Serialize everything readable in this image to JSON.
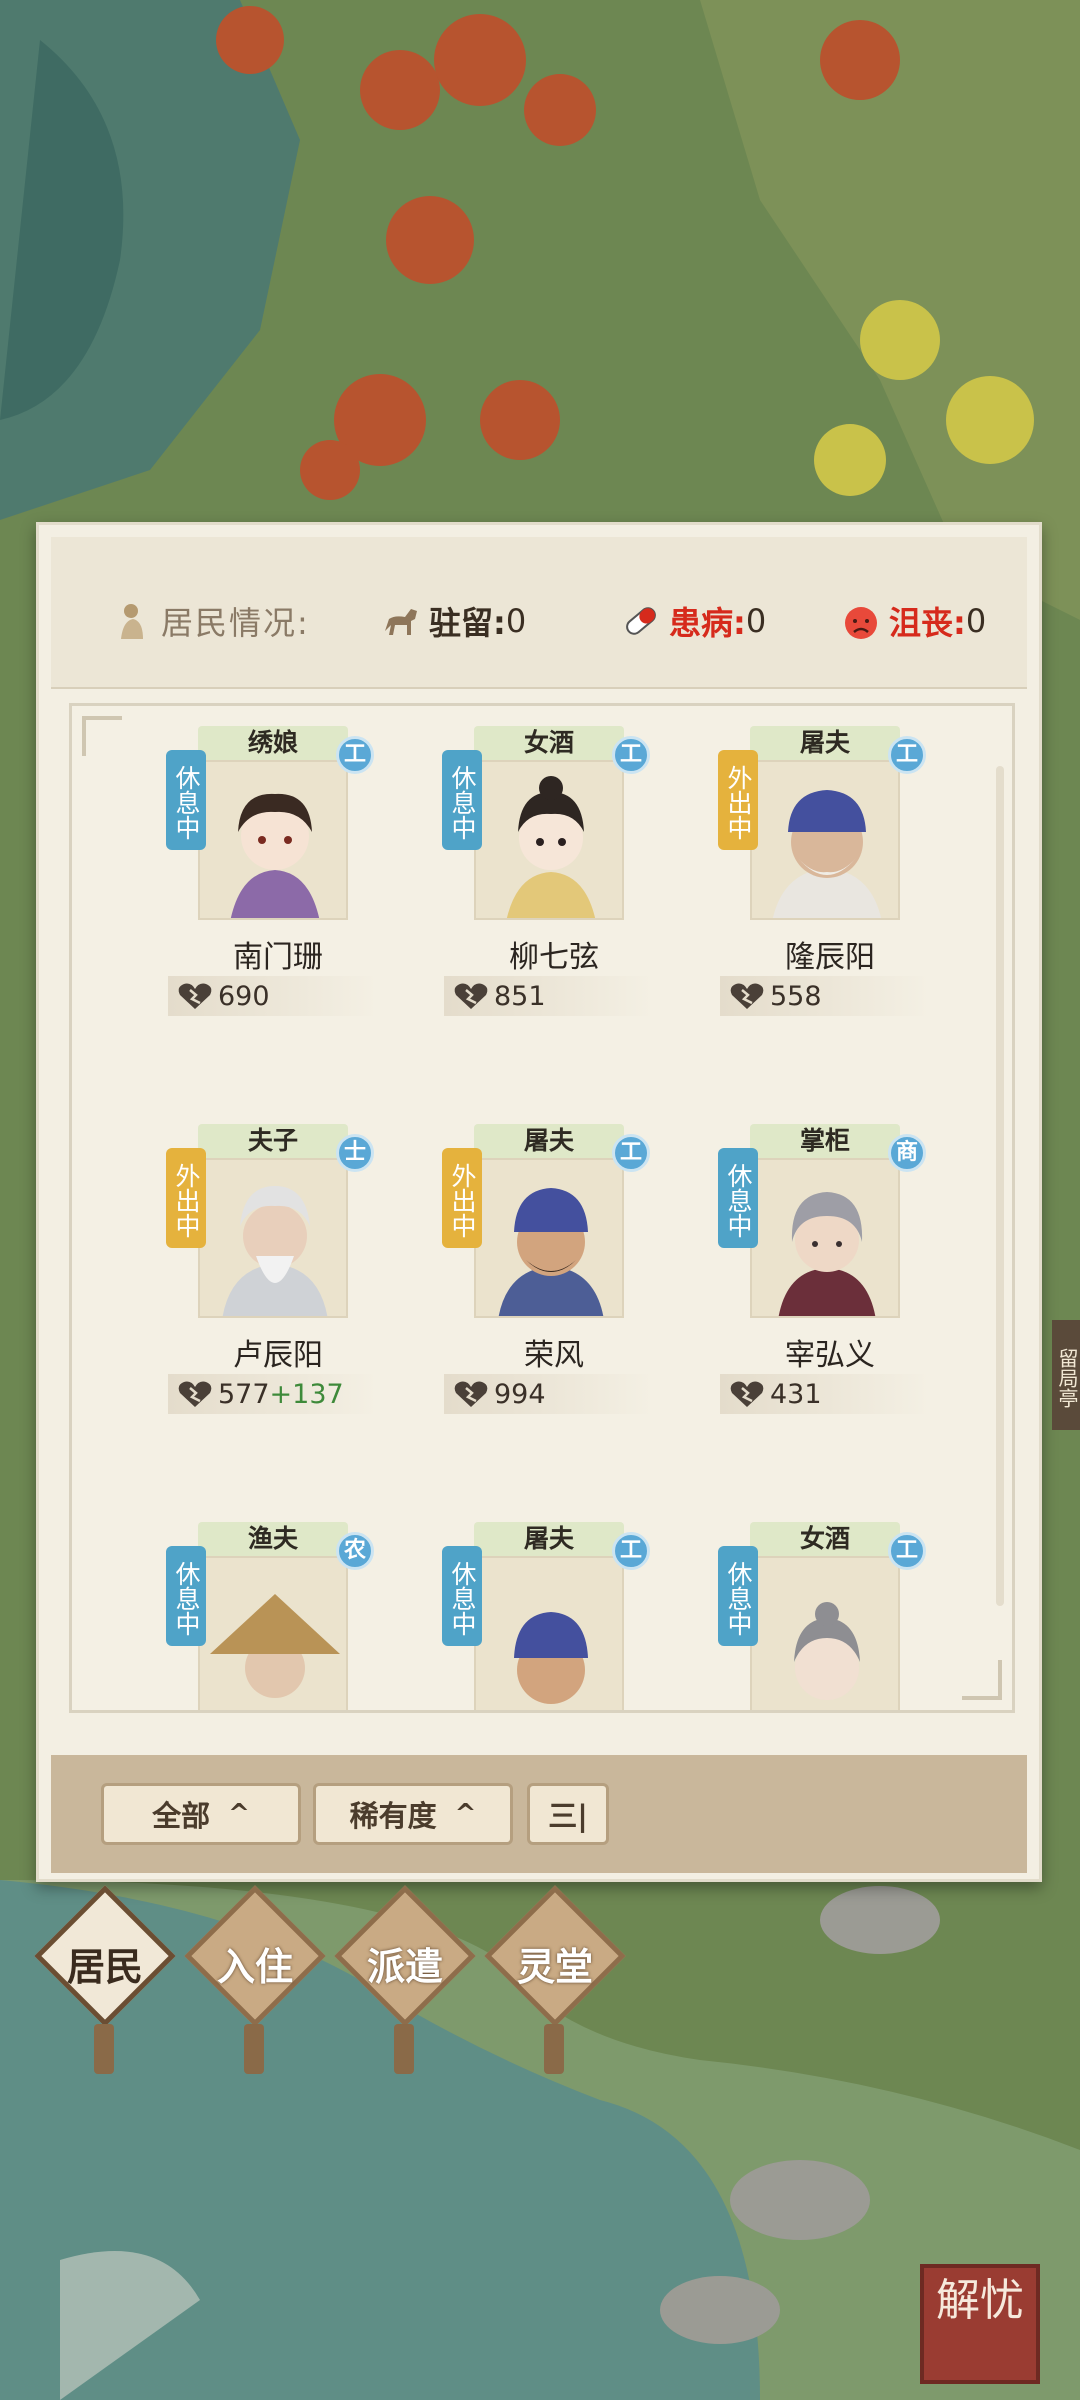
{
  "header": {
    "residents_label": "居民情况:",
    "stationed_label": "驻留:",
    "stationed_value": "0",
    "sick_label": "患病:",
    "sick_value": "0",
    "depressed_label": "沮丧:",
    "depressed_value": "0"
  },
  "residents": [
    {
      "role": "绣娘",
      "status": "休息中",
      "status_type": "rest",
      "class": "工",
      "name": "南门珊",
      "favor": "690",
      "bonus": ""
    },
    {
      "role": "女酒",
      "status": "休息中",
      "status_type": "rest",
      "class": "工",
      "name": "柳七弦",
      "favor": "851",
      "bonus": ""
    },
    {
      "role": "屠夫",
      "status": "外出中",
      "status_type": "out",
      "class": "工",
      "name": "隆辰阳",
      "favor": "558",
      "bonus": ""
    },
    {
      "role": "夫子",
      "status": "外出中",
      "status_type": "out",
      "class": "士",
      "name": "卢辰阳",
      "favor": "577",
      "bonus": "+137"
    },
    {
      "role": "屠夫",
      "status": "外出中",
      "status_type": "out",
      "class": "工",
      "name": "荣风",
      "favor": "994",
      "bonus": ""
    },
    {
      "role": "掌柜",
      "status": "休息中",
      "status_type": "rest",
      "class": "商",
      "name": "宰弘义",
      "favor": "431",
      "bonus": ""
    },
    {
      "role": "渔夫",
      "status": "休息中",
      "status_type": "rest",
      "class": "农",
      "name": "",
      "favor": "",
      "bonus": ""
    },
    {
      "role": "屠夫",
      "status": "休息中",
      "status_type": "rest",
      "class": "工",
      "name": "",
      "favor": "",
      "bonus": ""
    },
    {
      "role": "女酒",
      "status": "休息中",
      "status_type": "rest",
      "class": "工",
      "name": "",
      "favor": "",
      "bonus": ""
    }
  ],
  "toolbar": {
    "filter_all": "全部",
    "filter_rarity": "稀有度",
    "chevron": "^",
    "sort_icon": "三|"
  },
  "tabs": [
    "居民",
    "入住",
    "派遣",
    "灵堂"
  ],
  "map": {
    "side_sign": "留局亭",
    "seal_text": "解忧"
  },
  "colors": {
    "rest": "#4fa3c8",
    "out": "#e5b23d",
    "alert": "#d62a1c",
    "bonus": "#3e8a3a"
  }
}
